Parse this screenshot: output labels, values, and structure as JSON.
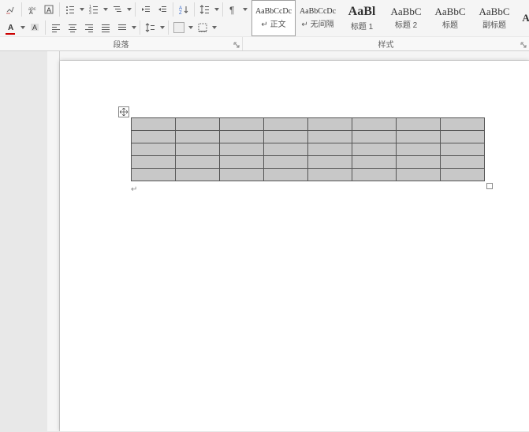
{
  "ribbon": {
    "group_paragraph": "段落",
    "group_styles": "样式"
  },
  "styles": [
    {
      "preview": "AaBbCcDc",
      "label": "↵ 正文",
      "size": "10px",
      "bold": false,
      "selected": true
    },
    {
      "preview": "AaBbCcDc",
      "label": "↵ 无间隔",
      "size": "10px",
      "bold": false,
      "selected": false
    },
    {
      "preview": "AaBl",
      "label": "标题 1",
      "size": "16px",
      "bold": true,
      "selected": false
    },
    {
      "preview": "AaBbC",
      "label": "标题 2",
      "size": "13px",
      "bold": false,
      "selected": false
    },
    {
      "preview": "AaBbC",
      "label": "标题",
      "size": "13px",
      "bold": false,
      "selected": false
    },
    {
      "preview": "AaBbC",
      "label": "副标题",
      "size": "13px",
      "bold": false,
      "selected": false
    },
    {
      "preview": "AaBbC",
      "label": "",
      "size": "13px",
      "bold": true,
      "selected": false
    }
  ],
  "table": {
    "rows": 5,
    "cols": 8
  },
  "icons": {
    "clear_format": "clear-format-icon",
    "phonetic": "phonetic-icon",
    "char_border": "char-border-icon",
    "font_color": "font-color-icon",
    "highlight": "highlight-icon",
    "bullets": "bullets-icon",
    "numbering": "numbering-icon",
    "multilevel": "multilevel-icon",
    "dec_indent": "decrease-indent-icon",
    "inc_indent": "increase-indent-icon",
    "sort": "sort-icon",
    "show_marks": "show-marks-icon",
    "align_left": "align-left-icon",
    "align_center": "align-center-icon",
    "align_right": "align-right-icon",
    "align_just": "align-justify-icon",
    "line_spacing": "line-spacing-icon",
    "shading": "shading-icon",
    "borders": "borders-icon"
  }
}
